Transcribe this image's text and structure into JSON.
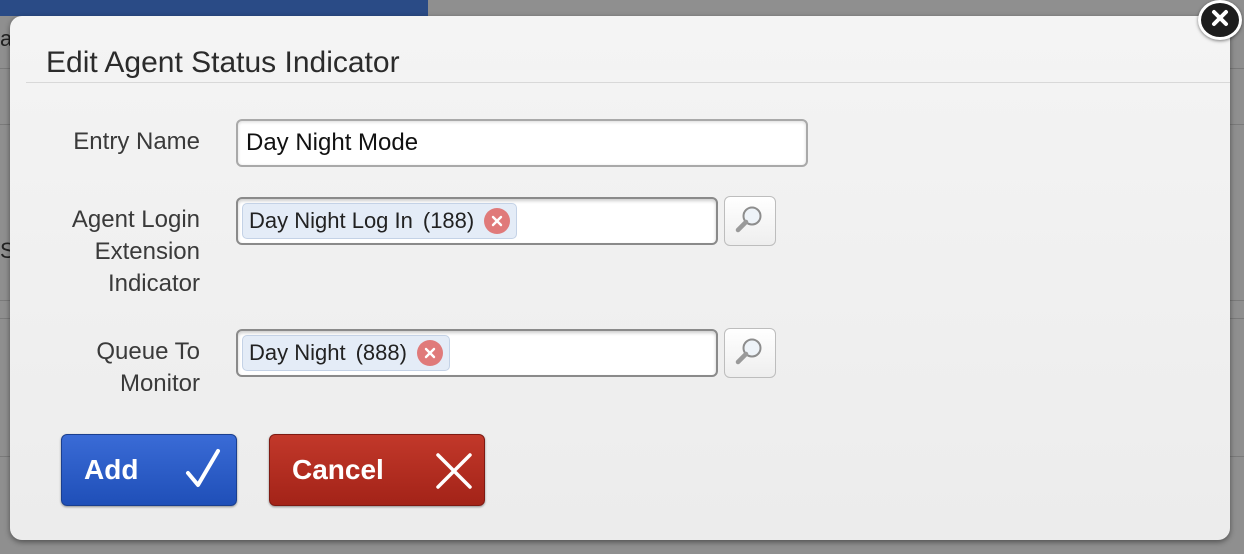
{
  "background": {
    "fragment_top": "a",
    "fragment_mid": "S"
  },
  "dialog": {
    "title": "Edit Agent Status Indicator",
    "close_icon": "close-icon"
  },
  "form": {
    "entry_name": {
      "label": "Entry Name",
      "value": "Day Night Mode"
    },
    "agent_login": {
      "label_lines": [
        "Agent Login",
        "Extension",
        "Indicator"
      ],
      "token_label": "Day Night Log In",
      "token_value": "(188)",
      "lookup_icon": "magnifier-icon"
    },
    "queue": {
      "label_lines": [
        "Queue To",
        "Monitor"
      ],
      "token_label": "Day Night",
      "token_value": "(888)",
      "lookup_icon": "magnifier-icon"
    }
  },
  "buttons": {
    "add_label": "Add",
    "add_icon": "checkmark-icon",
    "cancel_label": "Cancel",
    "cancel_icon": "x-icon"
  },
  "colors": {
    "add": "#2756c4",
    "cancel": "#b02a1e",
    "token_bg": "#e4ecf7",
    "remove": "#e07a7a"
  }
}
